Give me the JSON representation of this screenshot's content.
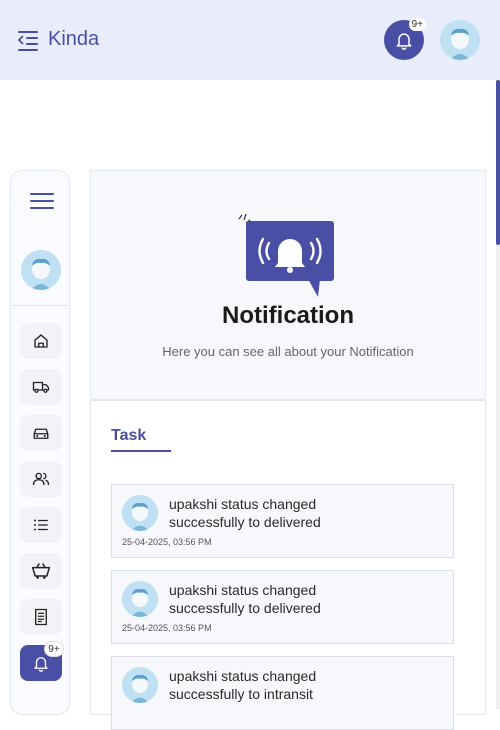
{
  "header": {
    "brand": "Kinda",
    "notification_badge": "9+",
    "icons": [
      "menu-collapse-icon",
      "bell-icon",
      "avatar"
    ]
  },
  "sidebar": {
    "items": [
      {
        "name": "home-icon"
      },
      {
        "name": "truck-icon"
      },
      {
        "name": "car-icon"
      },
      {
        "name": "users-icon"
      },
      {
        "name": "list-icon"
      },
      {
        "name": "cart-icon"
      },
      {
        "name": "document-icon"
      },
      {
        "name": "bell-icon",
        "badge": "9+",
        "active": true
      }
    ]
  },
  "main": {
    "title": "Notification",
    "subtitle": "Here you can see all about your Notification",
    "tab": "Task",
    "notifications": [
      {
        "line1": "upakshi status changed",
        "line2": "successfully to delivered",
        "time": "25-04-2025, 03:56 PM"
      },
      {
        "line1": "upakshi status changed",
        "line2": "successfully to delivered",
        "time": "25-04-2025, 03:56 PM"
      },
      {
        "line1": "upakshi status changed",
        "line2": "successfully to intransit",
        "time": ""
      }
    ]
  },
  "colors": {
    "accent": "#4a4fa6",
    "header_bg": "#e8ecfb",
    "avatar_bg": "#bfe1f3"
  }
}
